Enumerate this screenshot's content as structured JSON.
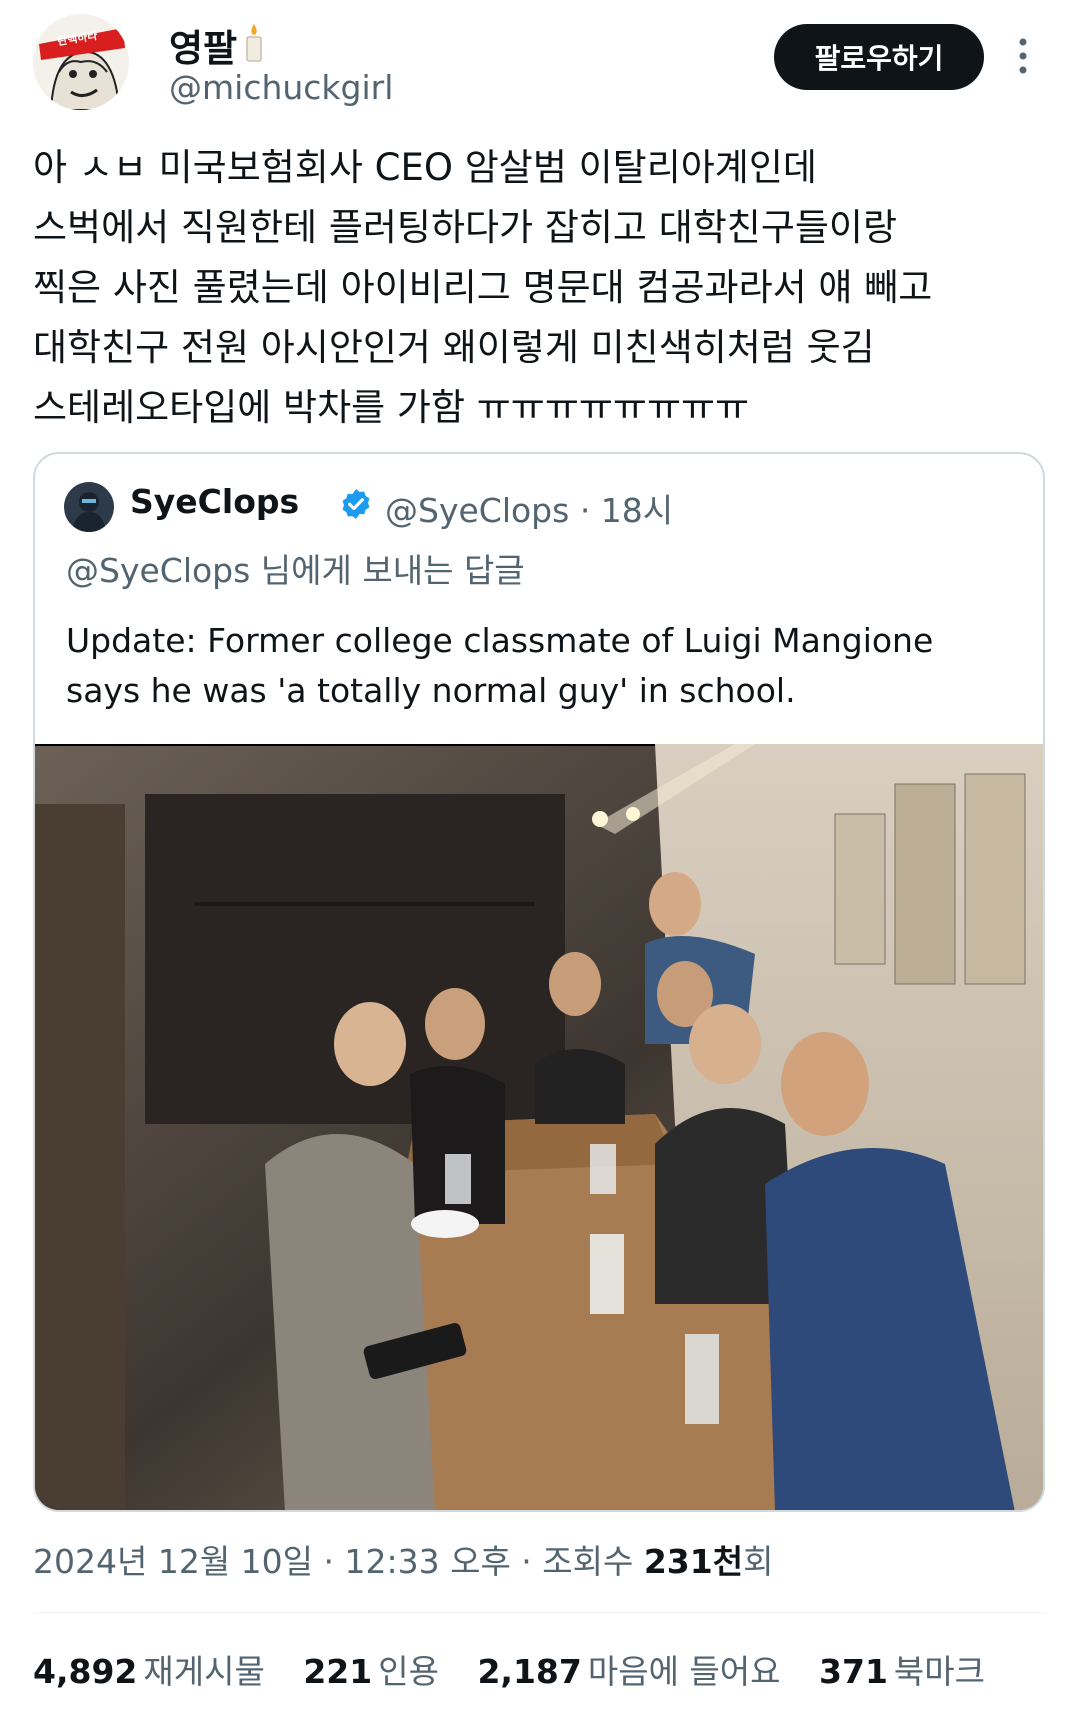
{
  "author": {
    "display_name": "영팔",
    "name_emoji": "candle-icon",
    "handle": "@michuckgirl",
    "avatar_badge_text": "탄핵하라"
  },
  "follow_label": "팔로우하기",
  "tweet_lines": [
    "아 ㅅㅂ 미국보험회사 CEO 암살범 이탈리아계인데",
    "스벅에서 직원한테 플러팅하다가 잡히고 대학친구들이랑",
    "찍은 사진 풀렸는데 아이비리그 명문대 컴공과라서 얘 빼고",
    "대학친구 전원 아시안인거 왜이렇게 미친색히처럼 웃김",
    "스테레오타입에 박차를 가함 ㅠㅠㅠㅠㅠㅠㅠㅠ"
  ],
  "quote": {
    "display_name": "SyeClops",
    "handle": "@SyeClops",
    "time": "· 18시",
    "reply_to": "@SyeClops 님에게 보내는 답글",
    "text": "Update: Former college classmate of Luigi Mangione says he was 'a totally normal guy' in school.",
    "verified": true
  },
  "timestamp": {
    "date_time": "2024년 12월 10일 · 12:33 오후 · 조회수 ",
    "views": "231천",
    "views_suffix": "회"
  },
  "stats": [
    {
      "count": "4,892",
      "label": "재게시물"
    },
    {
      "count": "221",
      "label": "인용"
    },
    {
      "count": "2,187",
      "label": "마음에 들어요"
    },
    {
      "count": "371",
      "label": "북마크"
    }
  ],
  "colors": {
    "text": "#0f1419",
    "secondary": "#536471",
    "verified": "#1d9bf0",
    "border": "#cfd9de",
    "button": "#0f1419"
  }
}
